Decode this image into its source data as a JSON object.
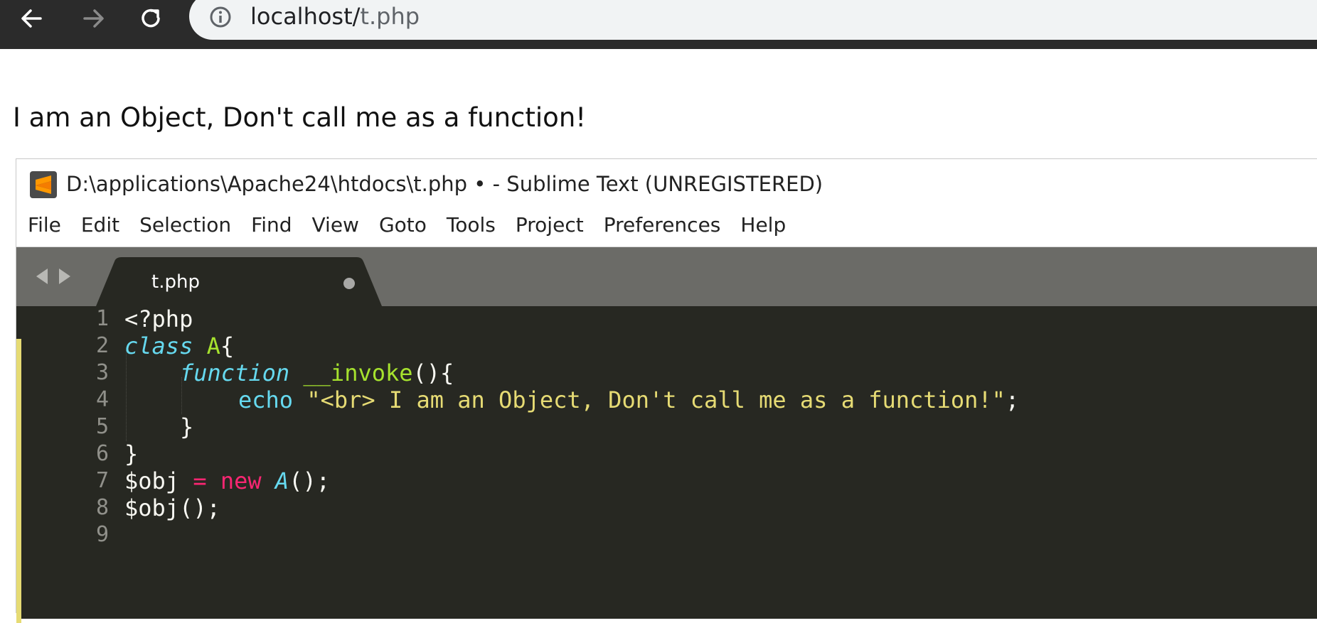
{
  "browser": {
    "url_host": "localhost/",
    "url_path": "t.php"
  },
  "page": {
    "output": "I am an Object, Don't call me as a function!"
  },
  "editor_window": {
    "title": "D:\\applications\\Apache24\\htdocs\\t.php • - Sublime Text (UNREGISTERED)",
    "menu": [
      "File",
      "Edit",
      "Selection",
      "Find",
      "View",
      "Goto",
      "Tools",
      "Project",
      "Preferences",
      "Help"
    ],
    "tab": {
      "label": "t.php",
      "dirty": true
    },
    "line_numbers": [
      "1",
      "2",
      "3",
      "4",
      "5",
      "6",
      "7",
      "8",
      "9"
    ],
    "code": {
      "l1": "<?php",
      "l2_kw": "class",
      "l2_name": "A",
      "l2_rest": "{",
      "l3_kw": "function",
      "l3_name": "__invoke",
      "l3_rest": "(){",
      "l4_kw": "echo",
      "l4_str": "\"<br> I am an Object, Don't call me as a function!\"",
      "l4_rest": ";",
      "l5": "}",
      "l6": "}",
      "l7_var": "$obj",
      "l7_op": "=",
      "l7_new": "new",
      "l7_cls": "A",
      "l7_rest": "();",
      "l8": "$obj();",
      "l9": ""
    }
  },
  "colors": {
    "editor_bg": "#272822",
    "keyword": "#66d9ef",
    "name": "#a6e22e",
    "string": "#e6db74",
    "operator": "#f92672"
  }
}
